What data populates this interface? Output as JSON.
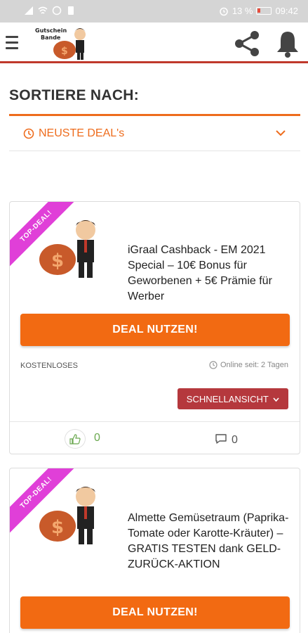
{
  "statusbar": {
    "battery": "13 %",
    "time": "09:42"
  },
  "header": {
    "logo_line1": "Gutschein",
    "logo_line2": "Bande"
  },
  "sort": {
    "title": "SORTIERE NACH:",
    "selected": "NEUSTE DEAL's"
  },
  "deals": [
    {
      "ribbon": "TOP-DEAL!",
      "title": "iGraal Cashback - EM 2021 Special – 10€ Bonus für Geworbenen + 5€ Prämie für Werber",
      "button": "DEAL NUTZEN!",
      "category": "KOSTENLOSES",
      "online": "Online seit: 2 Tagen",
      "quick_view": "SCHNELLANSICHT",
      "likes": "0",
      "comments": "0"
    },
    {
      "ribbon": "TOP-DEAL!",
      "title": "Almette Gemüsetraum (Paprika-Tomate oder Karotte-Kräuter) – GRATIS TESTEN dank GELD-ZURÜCK-AKTION",
      "button": "DEAL NUTZEN!"
    }
  ],
  "colors": {
    "accent": "#ee6c1d",
    "button": "#f26a12",
    "ribbon": "#e03fd8",
    "quick_view": "#b5383d",
    "header_line": "#c0392b"
  }
}
